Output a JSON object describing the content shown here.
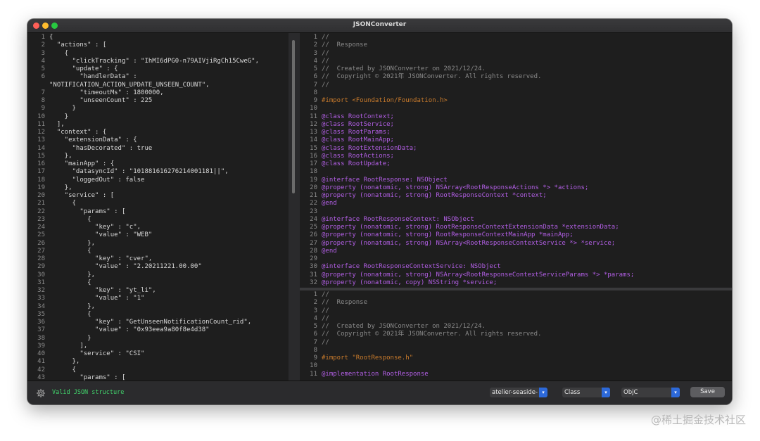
{
  "window": {
    "title": "JSONConverter"
  },
  "left_editor": {
    "lines": [
      "{",
      "  \"actions\" : [",
      "    {",
      "      \"clickTracking\" : \"IhMI6dPG0-n79AIVjiRgCh15CweG\",",
      "      \"update\" : {",
      "        \"handlerData\" :",
      "\"NOTIFICATION_ACTION_UPDATE_UNSEEN_COUNT\",",
      "        \"timeoutMs\" : 1800000,",
      "        \"unseenCount\" : 225",
      "      }",
      "    }",
      "  ],",
      "  \"context\" : {",
      "    \"extensionData\" : {",
      "      \"hasDecorated\" : true",
      "    },",
      "    \"mainApp\" : {",
      "      \"datasyncId\" : \"101881616276214001181||\",",
      "      \"loggedOut\" : false",
      "    },",
      "    \"service\" : [",
      "      {",
      "        \"params\" : [",
      "          {",
      "            \"key\" : \"c\",",
      "            \"value\" : \"WEB\"",
      "          },",
      "          {",
      "            \"key\" : \"cver\",",
      "            \"value\" : \"2.20211221.00.00\"",
      "          },",
      "          {",
      "            \"key\" : \"yt_li\",",
      "            \"value\" : \"1\"",
      "          },",
      "          {",
      "            \"key\" : \"GetUnseenNotificationCount_rid\",",
      "            \"value\" : \"0x93eea9a80f8e4d38\"",
      "          }",
      "        ],",
      "        \"service\" : \"CSI\"",
      "      },",
      "      {",
      "        \"params\" : ["
    ],
    "line_numbers": [
      "1",
      "2",
      "3",
      "4",
      "5",
      "6",
      "",
      "7",
      "8",
      "9",
      "10",
      "11",
      "12",
      "13",
      "14",
      "15",
      "16",
      "17",
      "18",
      "19",
      "20",
      "21",
      "22",
      "23",
      "24",
      "25",
      "26",
      "27",
      "28",
      "29",
      "30",
      "31",
      "32",
      "33",
      "34",
      "35",
      "36",
      "37",
      "38",
      "39",
      "40",
      "41",
      "42",
      "43"
    ]
  },
  "header_editor": {
    "lines": [
      "//",
      "//  Response",
      "//",
      "//",
      "//  Created by JSONConverter on 2021/12/24.",
      "//  Copyright © 2021年 JSONConverter. All rights reserved.",
      "//",
      "",
      "#import <Foundation/Foundation.h>",
      "",
      "@class RootContext;",
      "@class RootService;",
      "@class RootParams;",
      "@class RootMainApp;",
      "@class RootExtensionData;",
      "@class RootActions;",
      "@class RootUpdate;",
      "",
      "@interface RootResponse: NSObject",
      "@property (nonatomic, strong) NSArray<RootResponseActions *> *actions;",
      "@property (nonatomic, strong) RootResponseContext *context;",
      "@end",
      "",
      "@interface RootResponseContext: NSObject",
      "@property (nonatomic, strong) RootResponseContextExtensionData *extensionData;",
      "@property (nonatomic, strong) RootResponseContextMainApp *mainApp;",
      "@property (nonatomic, strong) NSArray<RootResponseContextService *> *service;",
      "@end",
      "",
      "@interface RootResponseContextService: NSObject",
      "@property (nonatomic, strong) NSArray<RootResponseContextServiceParams *> *params;",
      "@property (nonatomic, copy) NSString *service;"
    ],
    "line_numbers": [
      "1",
      "2",
      "3",
      "4",
      "5",
      "6",
      "7",
      "8",
      "9",
      "10",
      "11",
      "12",
      "13",
      "14",
      "15",
      "16",
      "17",
      "18",
      "19",
      "20",
      "21",
      "22",
      "23",
      "24",
      "25",
      "26",
      "27",
      "28",
      "29",
      "30",
      "31",
      "32"
    ]
  },
  "impl_editor": {
    "lines": [
      "//",
      "//  Response",
      "//",
      "//",
      "//  Created by JSONConverter on 2021/12/24.",
      "//  Copyright © 2021年 JSONConverter. All rights reserved.",
      "//",
      "",
      "#import \"RootResponse.h\"",
      "",
      "@implementation RootResponse"
    ],
    "line_numbers": [
      "1",
      "2",
      "3",
      "4",
      "5",
      "6",
      "7",
      "8",
      "9",
      "10",
      "11"
    ]
  },
  "bottom_bar": {
    "status": "Valid JSON structure",
    "theme_select": "atelier-seaside-",
    "type_select": "Class",
    "language_select": "ObjC",
    "save_label": "Save"
  },
  "watermark": "@稀土掘金技术社区",
  "colors": {
    "comment": "#8a8a8a",
    "directive": "#c97b2c",
    "keyword": "#b35fe6",
    "type": "#6e8ff0",
    "status_ok": "#41d26b",
    "select_arrow": "#2d69d9"
  }
}
